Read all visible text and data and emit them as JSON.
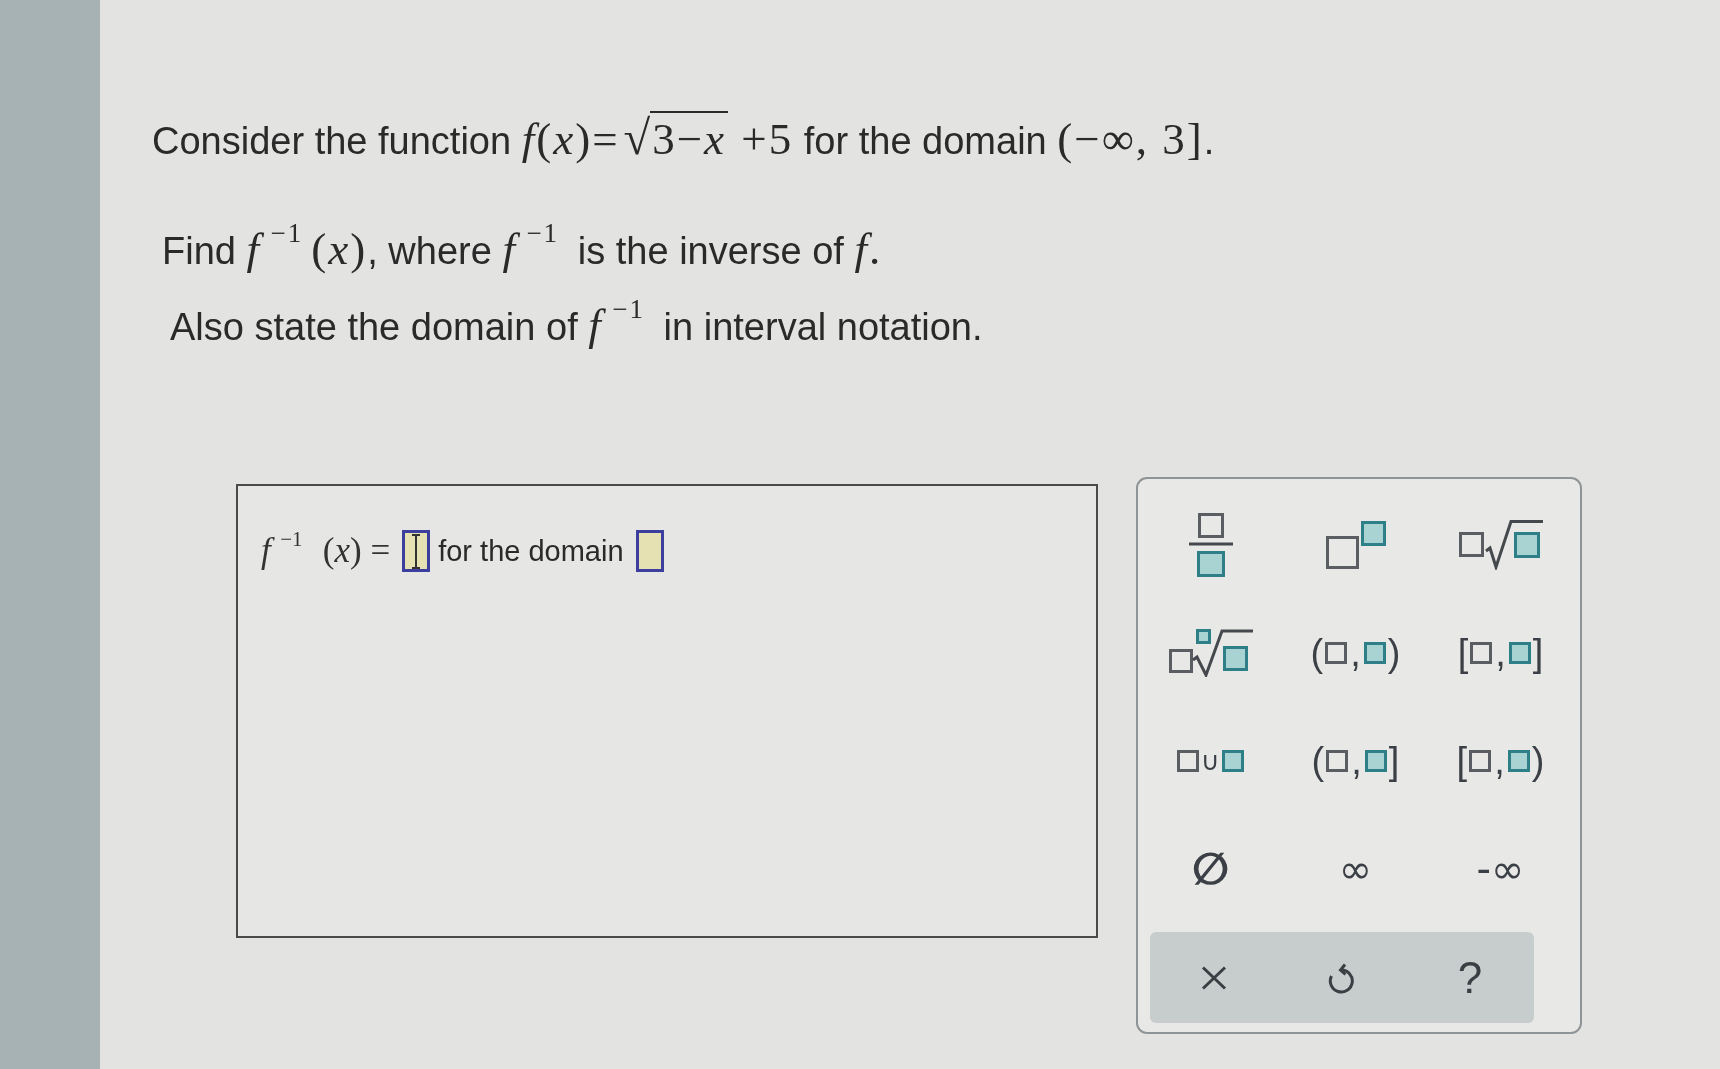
{
  "question": {
    "lines": [
      {
        "segments": [
          {
            "kind": "text",
            "text": "Consider the function "
          },
          {
            "kind": "math",
            "text": "*f*(*x*)="
          },
          {
            "kind": "sqrt",
            "sign": "√",
            "text": "3−*x*"
          },
          {
            "kind": "math",
            "text": " +5"
          },
          {
            "kind": "text",
            "text": " for the domain "
          },
          {
            "kind": "math",
            "text": "(−∞, 3]"
          },
          {
            "kind": "text",
            "text": "."
          }
        ]
      },
      {
        "segments": [
          {
            "kind": "text",
            "text": "Find "
          },
          {
            "kind": "math",
            "text": "*f*$^{−1}$(*x*)"
          },
          {
            "kind": "text",
            "text": ", where "
          },
          {
            "kind": "math",
            "text": "*f*$^{−1}$"
          },
          {
            "kind": "text",
            "text": " is the inverse of "
          },
          {
            "kind": "math",
            "text": "*f*."
          }
        ]
      },
      {
        "segments": [
          {
            "kind": "text",
            "text": "Also state the domain of "
          },
          {
            "kind": "math",
            "text": "*f*$^{−1}$"
          },
          {
            "kind": "text",
            "text": " in interval notation."
          }
        ]
      }
    ]
  },
  "answer": {
    "items": [
      {
        "kind": "math",
        "text": "*f*$^{−1}$ (*x*) ="
      },
      {
        "kind": "field",
        "focused": true
      },
      {
        "kind": "text",
        "text": "for the domain"
      },
      {
        "kind": "field",
        "focused": false
      }
    ]
  },
  "keypad": {
    "keys": [
      {
        "kind": "fraction"
      },
      {
        "kind": "power"
      },
      {
        "kind": "sqrt"
      },
      {
        "kind": "root"
      },
      {
        "kind": "interval",
        "left": "(",
        "separator": ",",
        "right": ")"
      },
      {
        "kind": "interval",
        "left": "[",
        "separator": ",",
        "right": "]"
      },
      {
        "kind": "union",
        "symbol": "∪"
      },
      {
        "kind": "interval",
        "left": "(",
        "separator": ",",
        "right": "]"
      },
      {
        "kind": "interval",
        "left": "[",
        "separator": ",",
        "right": ")"
      },
      {
        "kind": "empty_set",
        "symbol": "∅"
      },
      {
        "kind": "infinity",
        "symbol": "∞"
      },
      {
        "kind": "negative_infinity",
        "symbol": "-∞"
      }
    ],
    "actions": [
      {
        "kind": "clear"
      },
      {
        "kind": "undo"
      },
      {
        "kind": "help",
        "symbol": "?"
      }
    ]
  }
}
